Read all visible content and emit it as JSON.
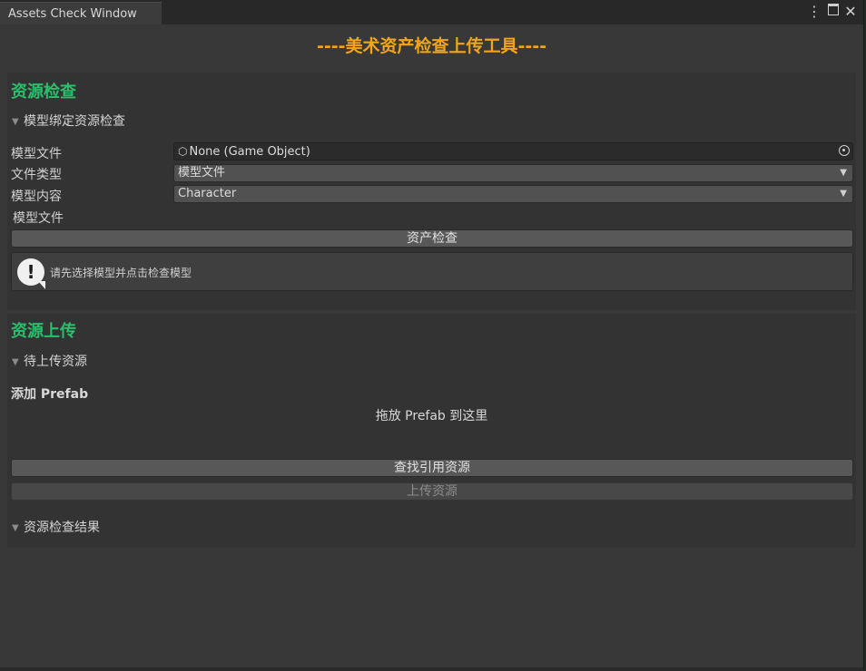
{
  "window": {
    "tab_title": "Assets Check Window",
    "controls": {
      "menu": "⋮",
      "maximize_icon": "maximize-icon",
      "close": "✕"
    }
  },
  "header": {
    "title": "----美术资产检查上传工具----",
    "title_color": "#f2a51a"
  },
  "check_section": {
    "heading": "资源检查",
    "heading_color": "#29c06c",
    "foldout_label": "模型绑定资源检查",
    "fields": {
      "model_file_label": "模型文件",
      "model_file_value": "None (Game Object)",
      "file_type_label": "文件类型",
      "file_type_value": "模型文件",
      "model_content_label": "模型内容",
      "model_content_value": "Character",
      "model_file_label2": "模型文件"
    },
    "check_button": "资产检查",
    "help_message": "请先选择模型并点击检查模型"
  },
  "upload_section": {
    "heading": "资源上传",
    "heading_color": "#29c06c",
    "pending_foldout": "待上传资源",
    "add_prefab_label": "添加 Prefab",
    "drop_hint": "拖放 Prefab 到这里",
    "find_refs_button": "查找引用资源",
    "upload_button": "上传资源",
    "result_foldout": "资源检查结果"
  },
  "glyphs": {
    "foldout_triangle": "▼",
    "dropdown_arrow": "▼",
    "object_icon": "⬡",
    "help_glyph": "!"
  }
}
